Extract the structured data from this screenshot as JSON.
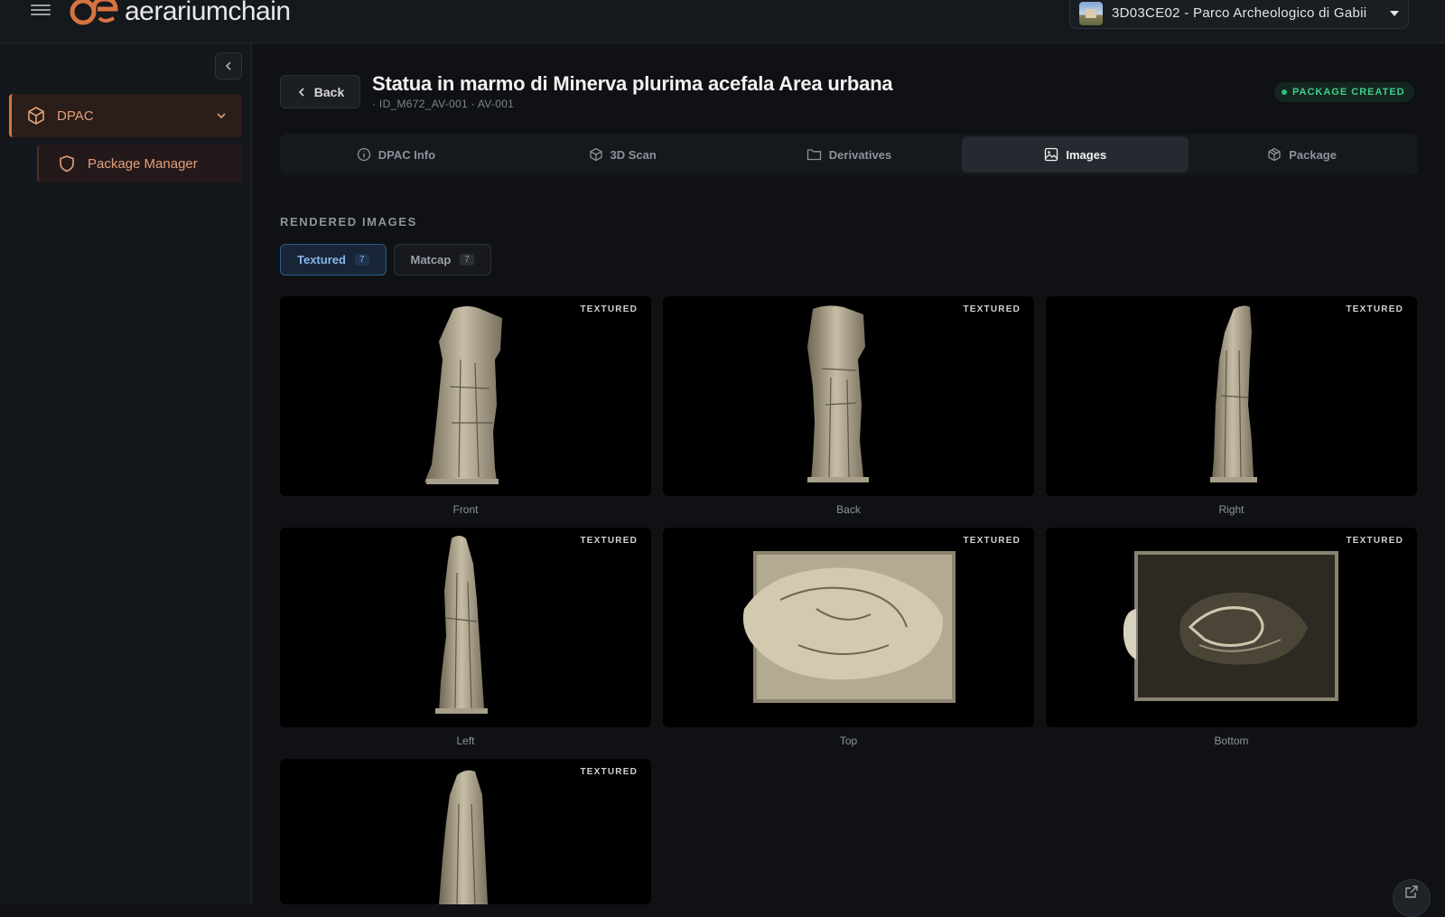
{
  "topbar": {
    "logo_text": "aerariumchain",
    "site_selector": "3D03CE02 - Parco Archeologico di Gabii"
  },
  "sidebar": {
    "group_label": "DPAC",
    "item_label": "Package Manager"
  },
  "header": {
    "back_label": "Back",
    "title": "Statua in marmo di Minerva plurima acefala Area urbana",
    "subtitle": "· ID_M672_AV-001 · AV-001",
    "status": "PACKAGE CREATED"
  },
  "tabs": [
    {
      "label": "DPAC Info",
      "icon": "info-icon"
    },
    {
      "label": "3D Scan",
      "icon": "cube-icon"
    },
    {
      "label": "Derivatives",
      "icon": "folder-icon"
    },
    {
      "label": "Images",
      "icon": "image-icon",
      "active": true
    },
    {
      "label": "Package",
      "icon": "package-icon"
    }
  ],
  "section": {
    "title": "RENDERED IMAGES",
    "subtabs": [
      {
        "label": "Textured",
        "count": "7",
        "active": true
      },
      {
        "label": "Matcap",
        "count": "7"
      }
    ]
  },
  "images": [
    {
      "badge": "TEXTURED",
      "caption": "Front"
    },
    {
      "badge": "TEXTURED",
      "caption": "Back"
    },
    {
      "badge": "TEXTURED",
      "caption": "Right"
    },
    {
      "badge": "TEXTURED",
      "caption": "Left"
    },
    {
      "badge": "TEXTURED",
      "caption": "Top"
    },
    {
      "badge": "TEXTURED",
      "caption": "Bottom"
    },
    {
      "badge": "TEXTURED",
      "caption": ""
    }
  ],
  "colors": {
    "accent": "#d6733f",
    "status_green": "#3fcf8a",
    "active_blue": "#86b7ee"
  }
}
